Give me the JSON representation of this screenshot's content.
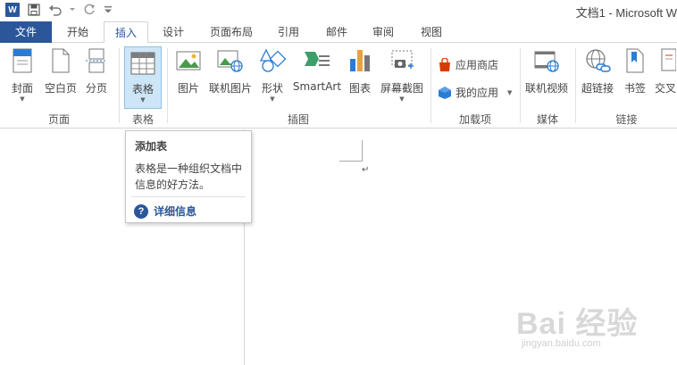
{
  "window": {
    "title": "文档1 - Microsoft W"
  },
  "quick_access": {
    "word_icon": "word-logo-icon",
    "logo_text": "W",
    "items": [
      "save-icon",
      "undo-icon",
      "redo-icon",
      "customize-icon"
    ]
  },
  "tabs": [
    {
      "label": "文件"
    },
    {
      "label": "开始"
    },
    {
      "label": "插入"
    },
    {
      "label": "设计"
    },
    {
      "label": "页面布局"
    },
    {
      "label": "引用"
    },
    {
      "label": "邮件"
    },
    {
      "label": "审阅"
    },
    {
      "label": "视图"
    }
  ],
  "active_tab": "插入",
  "ribbon": {
    "pages": {
      "cover": "封面",
      "blank": "空白页",
      "break": "分页",
      "group": "页面"
    },
    "tables": {
      "table": "表格",
      "group": "表格"
    },
    "illustrations": {
      "picture": "图片",
      "online_picture": "联机图片",
      "shapes": "形状",
      "smartart": "SmartArt",
      "chart": "图表",
      "screenshot": "屏幕截图",
      "group": "插图"
    },
    "addins": {
      "store": "应用商店",
      "my_apps": "我的应用",
      "group": "加载项"
    },
    "media": {
      "online_video": "联机视频",
      "group": "媒体"
    },
    "links": {
      "hyperlink": "超链接",
      "bookmark": "书签",
      "cross_ref": "交叉",
      "group": "链接"
    }
  },
  "tooltip": {
    "title": "添加表",
    "body": "表格是一种组织文档中信息的好方法。",
    "more": "详细信息"
  },
  "document": {
    "paragraph_mark": "↵"
  },
  "watermark": {
    "main": "Bai 经验",
    "url": "jingyan.baidu.com"
  },
  "colors": {
    "accent": "#2b579a",
    "selected_bg": "#cde6f7"
  }
}
